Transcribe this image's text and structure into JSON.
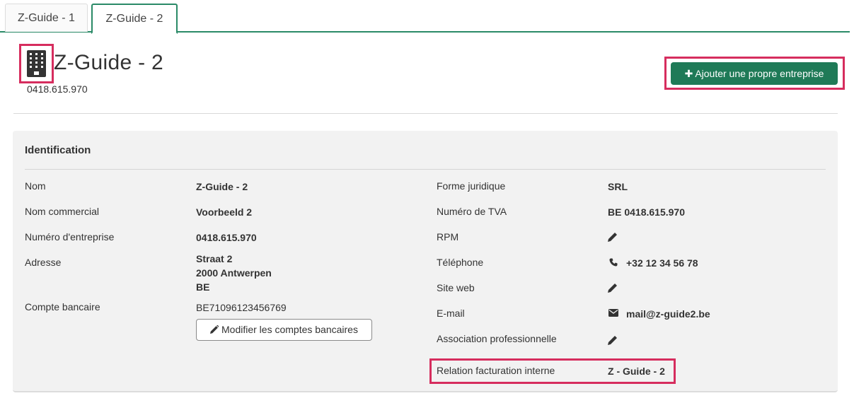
{
  "tabs": [
    {
      "label": "Z-Guide - 1"
    },
    {
      "label": "Z-Guide - 2"
    }
  ],
  "header": {
    "title": "Z-Guide - 2",
    "company_number": "0418.615.970",
    "add_button_label": "Ajouter une propre entreprise"
  },
  "identification": {
    "title": "Identification",
    "left": {
      "nom_label": "Nom",
      "nom_value": "Z-Guide - 2",
      "commercial_label": "Nom commercial",
      "commercial_value": "Voorbeeld 2",
      "entreprise_label": "Numéro d'entreprise",
      "entreprise_value": "0418.615.970",
      "adresse_label": "Adresse",
      "adresse_lines": [
        "Straat 2",
        "2000 Antwerpen",
        "BE"
      ],
      "compte_label": "Compte bancaire",
      "compte_value": "BE71096123456769",
      "modify_bank_label": "Modifier les comptes bancaires"
    },
    "right": {
      "forme_label": "Forme juridique",
      "forme_value": "SRL",
      "tva_label": "Numéro de TVA",
      "tva_value": "BE 0418.615.970",
      "rpm_label": "RPM",
      "telephone_label": "Téléphone",
      "telephone_value": "+32 12 34 56 78",
      "site_label": "Site web",
      "email_label": "E-mail",
      "email_value": "mail@z-guide2.be",
      "association_label": "Association professionnelle",
      "relation_label": "Relation facturation interne",
      "relation_value": "Z - Guide - 2"
    }
  },
  "colors": {
    "accent_green": "#1f7a57",
    "highlight_pink": "#d62d5e",
    "panel_bg": "#f2f2f2"
  },
  "icons": [
    "building-icon",
    "plus-icon",
    "pencil-icon",
    "phone-icon",
    "envelope-icon"
  ]
}
